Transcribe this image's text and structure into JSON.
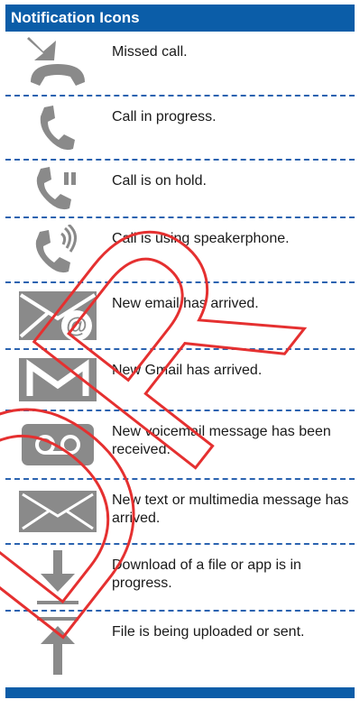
{
  "header": {
    "title": "Notification Icons"
  },
  "icons": [
    {
      "icon": "missed-call-icon",
      "label": "Missed call."
    },
    {
      "icon": "call-in-progress-icon",
      "label": "Call in progress."
    },
    {
      "icon": "call-on-hold-icon",
      "label": "Call is on hold."
    },
    {
      "icon": "speakerphone-icon",
      "label": "Call is using speakerphone."
    },
    {
      "icon": "new-email-icon",
      "label": "New email has arrived."
    },
    {
      "icon": "gmail-icon",
      "label": "New Gmail has arrived."
    },
    {
      "icon": "voicemail-icon",
      "label": "New voicemail message has been received."
    },
    {
      "icon": "text-message-icon",
      "label": "New text or multimedia message has arrived."
    },
    {
      "icon": "download-icon",
      "label": "Download of a file or app is in progress."
    },
    {
      "icon": "upload-icon",
      "label": "File is being uploaded or sent."
    }
  ],
  "watermark": {
    "text": "DR"
  },
  "colors": {
    "accent": "#0b5da8",
    "icon": "#8a8a8a",
    "watermark": "#e53030"
  }
}
